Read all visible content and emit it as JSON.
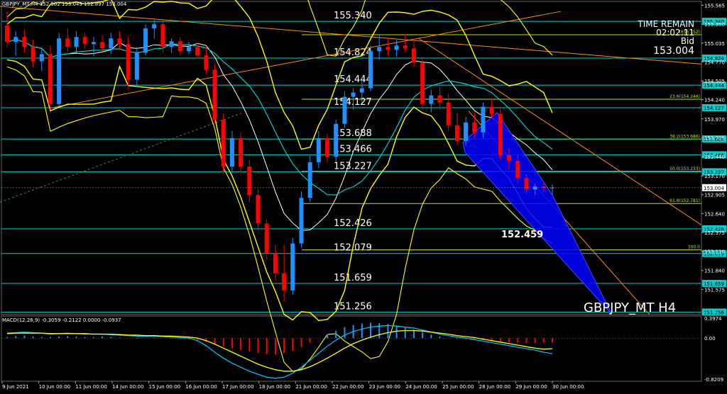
{
  "header": {
    "symbol_line": "GBPJPY_MT,H4  152.902 153.049 152.897 153.004"
  },
  "info_box": {
    "time_label": "TIME REMAIN",
    "time_value": "02:02:11",
    "bid_label": "Bid",
    "bid_value": "153.004"
  },
  "watermark": "GBPJPY_MT H4",
  "pattern_target": "152.459",
  "colors": {
    "background": "#000000",
    "bull_candle": "#1e90ff",
    "bear_candle": "#ff0000",
    "level_line": "#00cfcf",
    "fib_line": "#c8e000",
    "bollinger": "#ffff00",
    "trendline": "#ff8c00",
    "ma_line": "#ffffff",
    "pattern_fill": "#0000ff",
    "macd_signal": "#ffff00",
    "macd_main": "#00bfff",
    "price_tag": "#ffffff"
  },
  "chart_data": [
    {
      "type": "line",
      "pane": "price",
      "title": "GBPJPY_MT,H4",
      "ylim": [
        151.22,
        155.62
      ],
      "y_ticks": [
        "155.565",
        "155.300",
        "155.035",
        "154.770",
        "154.505",
        "154.240",
        "153.970",
        "153.705",
        "153.440",
        "153.170",
        "152.905",
        "152.640",
        "152.375",
        "152.110",
        "151.840",
        "151.575"
      ],
      "x_labels": [
        "9 Jun 2021",
        "10 Jun 00:00",
        "11 Jun 00:00",
        "14 Jun 00:00",
        "15 Jun 00:00",
        "16 Jun 00:00",
        "17 Jun 00:00",
        "18 Jun 00:00",
        "21 Jun 00:00",
        "22 Jun 00:00",
        "23 Jun 00:00",
        "24 Jun 00:00",
        "25 Jun 00:00",
        "28 Jun 00:00",
        "29 Jun 00:00",
        "30 Jun 00:00"
      ],
      "horizontal_levels": [
        {
          "value": 155.34,
          "label": "155.340",
          "tag": "155.340"
        },
        {
          "value": 154.824,
          "label": "154.824",
          "tag": "154.824"
        },
        {
          "value": 154.444,
          "label": "154.444",
          "tag": "154.444"
        },
        {
          "value": 154.127,
          "label": "154.127",
          "tag": "154.127"
        },
        {
          "value": 153.688,
          "label": "153.688",
          "tag": "153.688"
        },
        {
          "value": 153.466,
          "label": "153.466",
          "tag": "153.466"
        },
        {
          "value": 153.227,
          "label": "153.227",
          "tag": "153.227"
        },
        {
          "value": 152.426,
          "label": "152.426",
          "tag": "152.426"
        },
        {
          "value": 152.079,
          "label": "152.079",
          "tag": "152.079"
        },
        {
          "value": 151.659,
          "label": "151.659",
          "tag": "151.659"
        },
        {
          "value": 151.256,
          "label": "151.256",
          "tag": "151.256"
        }
      ],
      "fib_levels": [
        {
          "value": 155.152,
          "label": "(155.152)"
        },
        {
          "value": 154.246,
          "label": "23.6(154.246)"
        },
        {
          "value": 153.686,
          "label": "38.2(153.686)"
        },
        {
          "value": 153.233,
          "label": "50.0(153.233)"
        },
        {
          "value": 152.781,
          "label": "61.8(152.781)"
        },
        {
          "value": 152.13,
          "label": "100.0"
        }
      ],
      "current_price": 153.004,
      "candles": [
        {
          "o": 155.28,
          "h": 155.48,
          "l": 154.98,
          "c": 155.05
        },
        {
          "o": 155.05,
          "h": 155.2,
          "l": 154.86,
          "c": 155.12
        },
        {
          "o": 155.12,
          "h": 155.22,
          "l": 154.9,
          "c": 154.98
        },
        {
          "o": 154.98,
          "h": 155.08,
          "l": 154.7,
          "c": 154.78
        },
        {
          "o": 154.78,
          "h": 154.95,
          "l": 154.64,
          "c": 154.88
        },
        {
          "o": 154.88,
          "h": 155.0,
          "l": 154.1,
          "c": 154.18
        },
        {
          "o": 154.18,
          "h": 155.18,
          "l": 154.14,
          "c": 155.1
        },
        {
          "o": 155.1,
          "h": 155.24,
          "l": 154.92,
          "c": 154.98
        },
        {
          "o": 154.98,
          "h": 155.2,
          "l": 154.9,
          "c": 155.12
        },
        {
          "o": 155.12,
          "h": 155.18,
          "l": 154.95,
          "c": 155.02
        },
        {
          "o": 155.02,
          "h": 155.12,
          "l": 154.85,
          "c": 155.05
        },
        {
          "o": 155.05,
          "h": 155.14,
          "l": 154.92,
          "c": 154.96
        },
        {
          "o": 154.96,
          "h": 155.18,
          "l": 154.88,
          "c": 155.1
        },
        {
          "o": 155.1,
          "h": 155.2,
          "l": 154.95,
          "c": 155.02
        },
        {
          "o": 155.02,
          "h": 155.12,
          "l": 154.4,
          "c": 154.52
        },
        {
          "o": 154.52,
          "h": 154.98,
          "l": 154.42,
          "c": 154.9
        },
        {
          "o": 154.9,
          "h": 155.3,
          "l": 154.86,
          "c": 155.24
        },
        {
          "o": 155.24,
          "h": 155.36,
          "l": 155.1,
          "c": 155.3
        },
        {
          "o": 155.3,
          "h": 155.36,
          "l": 154.9,
          "c": 154.98
        },
        {
          "o": 154.98,
          "h": 155.1,
          "l": 154.9,
          "c": 155.06
        },
        {
          "o": 155.06,
          "h": 155.12,
          "l": 154.86,
          "c": 154.92
        },
        {
          "o": 154.92,
          "h": 155.05,
          "l": 154.88,
          "c": 154.98
        },
        {
          "o": 154.98,
          "h": 155.04,
          "l": 154.82,
          "c": 154.86
        },
        {
          "o": 154.86,
          "h": 154.98,
          "l": 154.6,
          "c": 154.66
        },
        {
          "o": 154.66,
          "h": 154.74,
          "l": 153.9,
          "c": 153.96
        },
        {
          "o": 153.96,
          "h": 154.04,
          "l": 153.2,
          "c": 153.3
        },
        {
          "o": 153.3,
          "h": 153.8,
          "l": 153.2,
          "c": 153.7
        },
        {
          "o": 153.7,
          "h": 153.78,
          "l": 153.2,
          "c": 153.3
        },
        {
          "o": 153.3,
          "h": 153.4,
          "l": 152.8,
          "c": 152.9
        },
        {
          "o": 152.9,
          "h": 152.98,
          "l": 152.4,
          "c": 152.5
        },
        {
          "o": 152.5,
          "h": 152.56,
          "l": 152.0,
          "c": 152.08
        },
        {
          "o": 152.08,
          "h": 152.2,
          "l": 151.7,
          "c": 151.8
        },
        {
          "o": 151.8,
          "h": 152.2,
          "l": 151.4,
          "c": 151.56
        },
        {
          "o": 151.56,
          "h": 152.3,
          "l": 151.5,
          "c": 152.22
        },
        {
          "o": 152.22,
          "h": 152.95,
          "l": 152.16,
          "c": 152.86
        },
        {
          "o": 152.86,
          "h": 153.45,
          "l": 152.8,
          "c": 153.36
        },
        {
          "o": 153.36,
          "h": 153.8,
          "l": 153.28,
          "c": 153.7
        },
        {
          "o": 153.7,
          "h": 153.76,
          "l": 153.36,
          "c": 153.44
        },
        {
          "o": 153.44,
          "h": 153.96,
          "l": 153.38,
          "c": 153.9
        },
        {
          "o": 153.9,
          "h": 154.36,
          "l": 153.84,
          "c": 154.28
        },
        {
          "o": 154.28,
          "h": 154.4,
          "l": 154.1,
          "c": 154.34
        },
        {
          "o": 154.34,
          "h": 154.56,
          "l": 154.2,
          "c": 154.4
        },
        {
          "o": 154.4,
          "h": 155.0,
          "l": 154.36,
          "c": 154.92
        },
        {
          "o": 154.92,
          "h": 155.16,
          "l": 154.8,
          "c": 154.98
        },
        {
          "o": 154.98,
          "h": 155.1,
          "l": 154.86,
          "c": 154.94
        },
        {
          "o": 154.94,
          "h": 155.08,
          "l": 154.84,
          "c": 155.0
        },
        {
          "o": 155.0,
          "h": 155.16,
          "l": 154.9,
          "c": 154.96
        },
        {
          "o": 154.96,
          "h": 155.1,
          "l": 154.7,
          "c": 154.76
        },
        {
          "o": 154.76,
          "h": 154.84,
          "l": 154.1,
          "c": 154.18
        },
        {
          "o": 154.18,
          "h": 154.38,
          "l": 154.06,
          "c": 154.3
        },
        {
          "o": 154.3,
          "h": 154.42,
          "l": 154.1,
          "c": 154.2
        },
        {
          "o": 154.2,
          "h": 154.32,
          "l": 153.8,
          "c": 153.88
        },
        {
          "o": 153.88,
          "h": 154.06,
          "l": 153.6,
          "c": 153.66
        },
        {
          "o": 153.66,
          "h": 154.0,
          "l": 153.6,
          "c": 153.92
        },
        {
          "o": 153.92,
          "h": 154.06,
          "l": 153.7,
          "c": 153.78
        },
        {
          "o": 153.78,
          "h": 154.2,
          "l": 153.7,
          "c": 154.14
        },
        {
          "o": 154.14,
          "h": 154.26,
          "l": 153.98,
          "c": 154.04
        },
        {
          "o": 154.04,
          "h": 154.12,
          "l": 153.4,
          "c": 153.46
        },
        {
          "o": 153.46,
          "h": 153.56,
          "l": 153.26,
          "c": 153.38
        },
        {
          "o": 153.38,
          "h": 153.46,
          "l": 153.06,
          "c": 153.14
        },
        {
          "o": 153.14,
          "h": 153.2,
          "l": 152.92,
          "c": 152.98
        },
        {
          "o": 152.98,
          "h": 153.06,
          "l": 152.9,
          "c": 153.02
        },
        {
          "o": 153.02,
          "h": 153.08,
          "l": 152.94,
          "c": 153.0
        },
        {
          "o": 153.0,
          "h": 153.05,
          "l": 152.9,
          "c": 153.004
        }
      ]
    },
    {
      "type": "bar",
      "pane": "macd",
      "title": "MACD(12,26,9) -0.3059 -0.2122 0.0000 -0.0937",
      "ylim": [
        -0.86,
        0.44
      ],
      "y_ticks": [
        "0.3974",
        "0.00",
        "-0.8209"
      ],
      "histogram": [
        0.02,
        0.04,
        0.05,
        0.03,
        0.02,
        0.02,
        0.03,
        0.04,
        0.03,
        0.02,
        0.02,
        0.03,
        0.02,
        0.01,
        0.0,
        -0.01,
        0.0,
        0.01,
        0.0,
        -0.01,
        -0.02,
        -0.03,
        -0.05,
        -0.08,
        -0.12,
        -0.16,
        -0.2,
        -0.24,
        -0.27,
        -0.3,
        -0.32,
        -0.33,
        -0.3,
        -0.25,
        -0.18,
        -0.09,
        0.0,
        0.08,
        0.15,
        0.22,
        0.26,
        0.29,
        0.31,
        0.3,
        0.28,
        0.25,
        0.21,
        0.17,
        0.12,
        0.07,
        0.03,
        0.0,
        -0.02,
        -0.03,
        -0.04,
        -0.04,
        -0.05,
        -0.07,
        -0.08,
        -0.09,
        -0.1,
        -0.1,
        -0.09,
        -0.09
      ],
      "series": [
        {
          "name": "Main",
          "values": [
            0.1,
            0.11,
            0.12,
            0.11,
            0.1,
            0.08,
            0.09,
            0.1,
            0.09,
            0.08,
            0.08,
            0.08,
            0.07,
            0.06,
            0.05,
            0.04,
            0.04,
            0.04,
            0.03,
            0.02,
            0.01,
            0.0,
            -0.05,
            -0.15,
            -0.28,
            -0.4,
            -0.5,
            -0.58,
            -0.66,
            -0.72,
            -0.78,
            -0.8,
            -0.78,
            -0.7,
            -0.58,
            -0.44,
            -0.3,
            -0.16,
            -0.04,
            0.06,
            0.13,
            0.18,
            0.22,
            0.24,
            0.25,
            0.24,
            0.22,
            0.2,
            0.16,
            0.12,
            0.08,
            0.05,
            0.02,
            0.0,
            -0.03,
            -0.06,
            -0.09,
            -0.12,
            -0.15,
            -0.18,
            -0.21,
            -0.24,
            -0.28,
            -0.31
          ]
        },
        {
          "name": "Signal",
          "values": [
            0.09,
            0.1,
            0.1,
            0.1,
            0.1,
            0.09,
            0.09,
            0.09,
            0.09,
            0.09,
            0.08,
            0.08,
            0.08,
            0.07,
            0.06,
            0.06,
            0.05,
            0.05,
            0.04,
            0.04,
            0.03,
            0.02,
            0.0,
            -0.05,
            -0.12,
            -0.2,
            -0.28,
            -0.36,
            -0.44,
            -0.52,
            -0.58,
            -0.63,
            -0.66,
            -0.66,
            -0.63,
            -0.57,
            -0.49,
            -0.4,
            -0.3,
            -0.2,
            -0.11,
            -0.04,
            0.02,
            0.07,
            0.11,
            0.14,
            0.15,
            0.15,
            0.14,
            0.12,
            0.1,
            0.08,
            0.05,
            0.03,
            0.01,
            -0.02,
            -0.05,
            -0.08,
            -0.11,
            -0.14,
            -0.17,
            -0.2,
            -0.22,
            -0.21
          ]
        }
      ]
    }
  ]
}
